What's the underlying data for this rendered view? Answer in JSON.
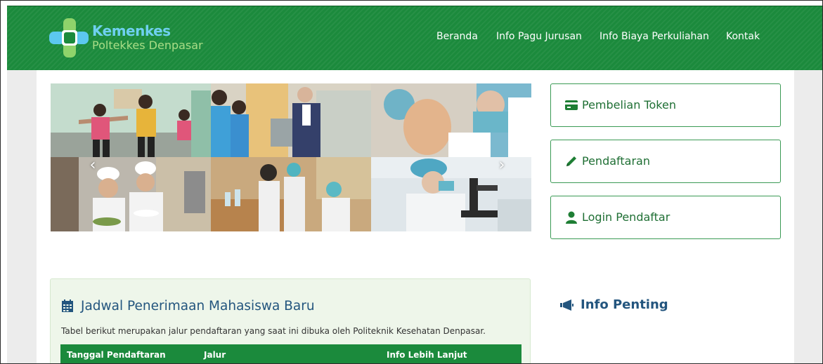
{
  "brand": {
    "title": "Kemenkes",
    "subtitle": "Poltekkes Denpasar"
  },
  "nav": [
    {
      "label": "Beranda"
    },
    {
      "label": "Info Pagu Jurusan"
    },
    {
      "label": "Info Biaya Perkuliahan"
    },
    {
      "label": "Kontak"
    }
  ],
  "carousel": {
    "prev_icon": "chevron-left-icon",
    "next_icon": "chevron-right-icon"
  },
  "actions": [
    {
      "label": "Pembelian Token",
      "icon": "credit-card-icon"
    },
    {
      "label": "Pendaftaran",
      "icon": "pencil-icon"
    },
    {
      "label": "Login Pendaftar",
      "icon": "user-icon"
    }
  ],
  "jadwal": {
    "title": "Jadwal Penerimaan Mahasiswa Baru",
    "icon": "calendar-icon",
    "description": "Tabel berikut merupakan jalur pendaftaran yang saat ini dibuka oleh Politeknik Kesehatan Denpasar.",
    "columns": [
      "Tanggal Pendaftaran",
      "Jalur",
      "Info Lebih Lanjut"
    ]
  },
  "info_penting": {
    "title": "Info Penting",
    "icon": "megaphone-icon"
  },
  "colors": {
    "header_green": "#1b8a3c",
    "heading_blue": "#23557e",
    "button_text": "#1f6f34"
  }
}
